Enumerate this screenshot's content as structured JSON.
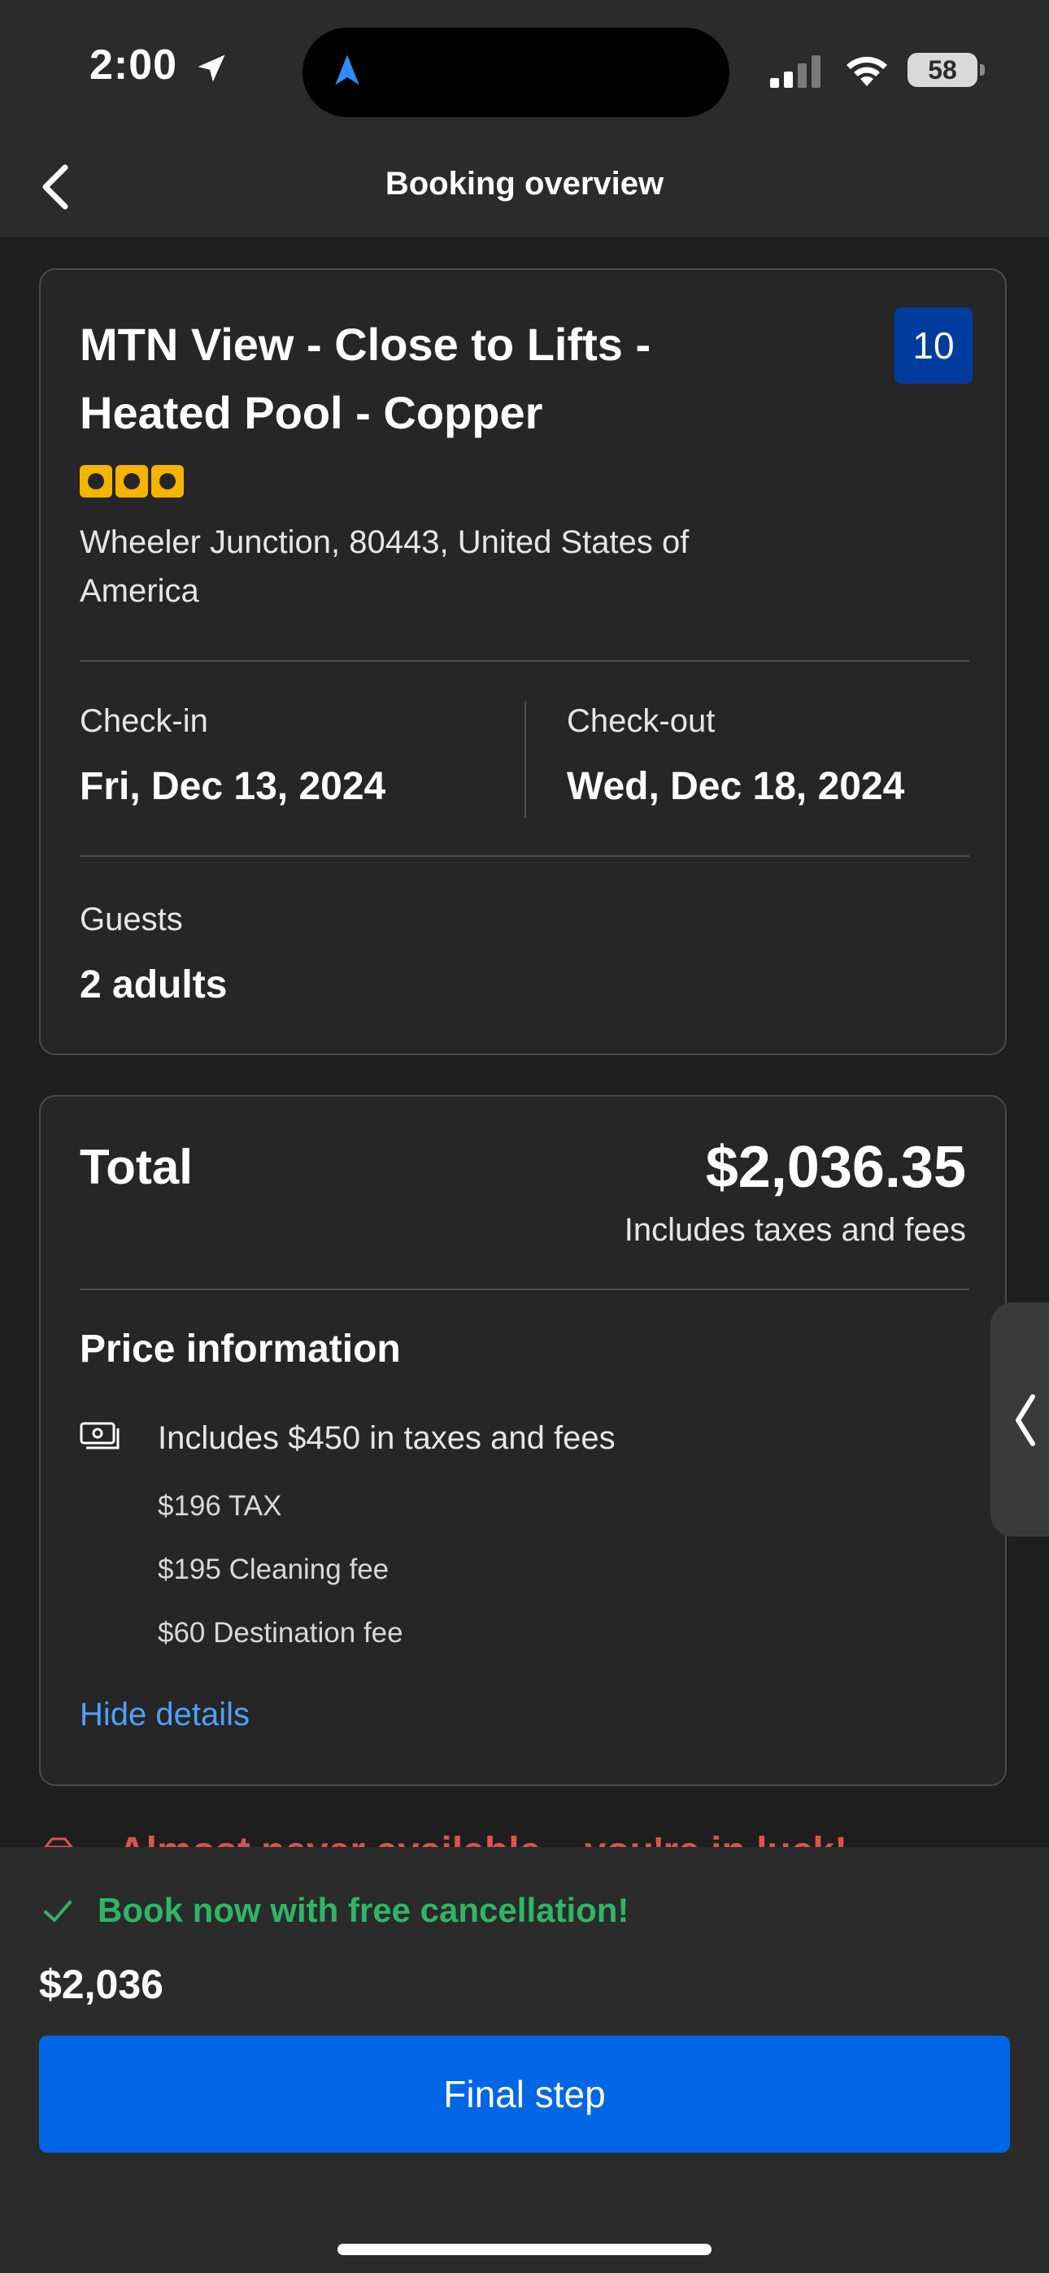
{
  "status_bar": {
    "time": "2:00",
    "battery": "58",
    "location_icon": "location-arrow-icon",
    "navigation_icon": "navigation-arrow-icon",
    "signal_icon": "cellular-signal-icon",
    "wifi_icon": "wifi-icon"
  },
  "header": {
    "title": "Booking overview",
    "back_icon": "chevron-left-icon"
  },
  "property": {
    "name": "MTN View - Close to Lifts - Heated Pool - Copper",
    "rating": "10",
    "rating_color": "#003c9e",
    "star_count": 3,
    "star_color": "#f4b400",
    "address": "Wheeler Junction, 80443, United States of America"
  },
  "stay": {
    "checkin_label": "Check-in",
    "checkin_value": "Fri, Dec 13, 2024",
    "checkout_label": "Check-out",
    "checkout_value": "Wed, Dec 18, 2024",
    "guests_label": "Guests",
    "guests_value": "2 adults"
  },
  "pricing": {
    "total_label": "Total",
    "total_amount": "$2,036.35",
    "total_note": "Includes taxes and fees",
    "info_title": "Price information",
    "money_icon": "money-bill-icon",
    "tax_summary": "Includes $450 in taxes and fees",
    "fees": [
      "$196 TAX",
      "$195 Cleaning fee",
      "$60 Destination fee"
    ],
    "hide_details": "Hide details"
  },
  "promo": {
    "text": "Almost never available – you're in luck!",
    "icon": "diamond-icon",
    "color": "#d9534f"
  },
  "bottom": {
    "free_cancellation": "Book now with free cancellation!",
    "check_icon": "checkmark-icon",
    "price": "$2,036",
    "button_label": "Final step",
    "button_color": "#0066e6"
  }
}
